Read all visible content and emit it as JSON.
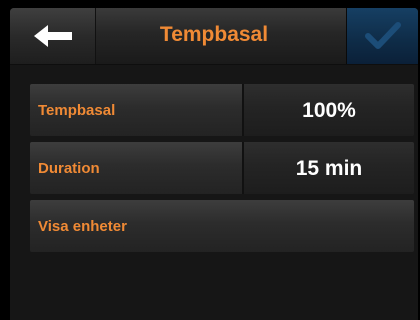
{
  "header": {
    "title": "Tempbasal",
    "back_icon": "left-arrow-icon",
    "confirm_icon": "checkmark-icon",
    "confirm_color": "#0f2d49"
  },
  "settings": {
    "rows": [
      {
        "label": "Tempbasal",
        "value": "100%"
      },
      {
        "label": "Duration",
        "value": "15 min"
      },
      {
        "label": "Visa enheter"
      }
    ]
  },
  "colors": {
    "accent": "#f08a35",
    "value_text": "#ffffff",
    "background": "#161616"
  }
}
